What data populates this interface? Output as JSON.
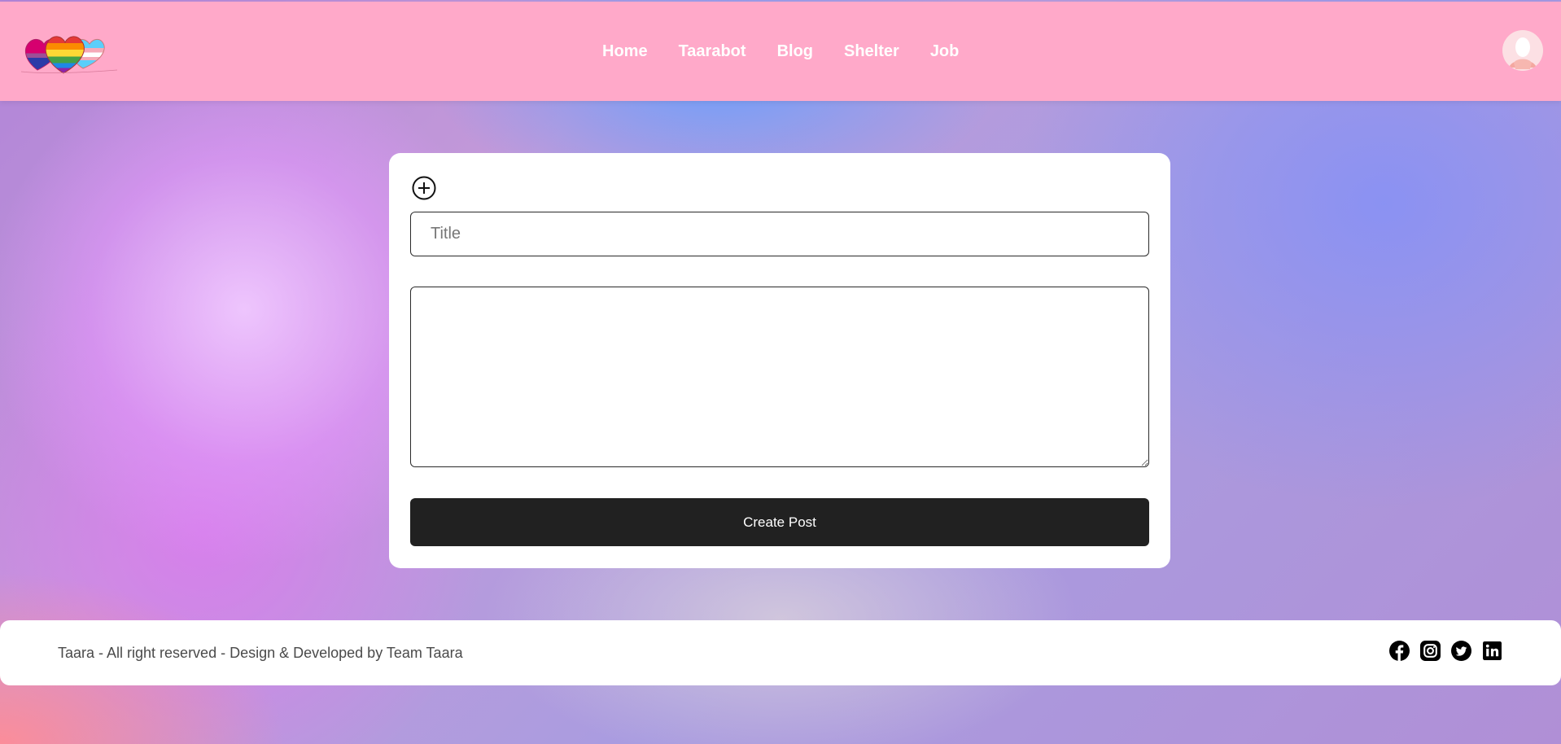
{
  "header": {
    "logo_icon": "rainbow-hearts-logo",
    "nav": [
      {
        "label": "Home"
      },
      {
        "label": "Taarabot"
      },
      {
        "label": "Blog"
      },
      {
        "label": "Shelter"
      },
      {
        "label": "Job"
      }
    ],
    "avatar_icon": "user-avatar-icon",
    "background": "#ffa9c9"
  },
  "form": {
    "add_icon": "plus-circle-icon",
    "title_placeholder": "Title",
    "title_value": "",
    "body_value": "",
    "submit_label": "Create Post",
    "submit_color": "#212121"
  },
  "footer": {
    "text": "Taara - All right reserved - Design & Developed by Team Taara",
    "social_icons": [
      "facebook-icon",
      "instagram-icon",
      "twitter-icon",
      "linkedin-icon"
    ]
  }
}
